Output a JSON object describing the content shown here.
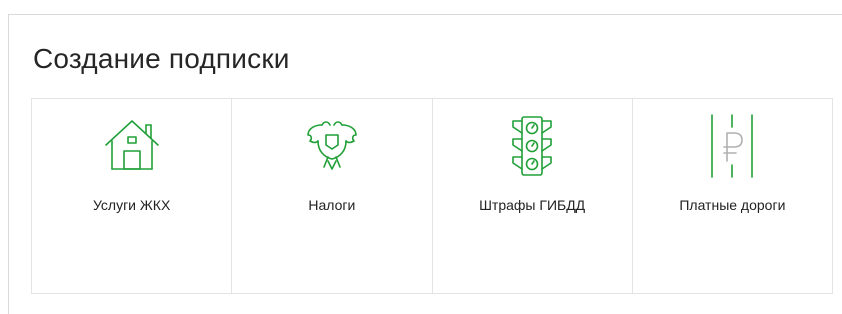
{
  "title": "Создание подписки",
  "accent_color": "#21a038",
  "tiles": [
    {
      "label": "Услуги ЖКХ",
      "icon": "house-icon"
    },
    {
      "label": "Налоги",
      "icon": "eagle-emblem-icon"
    },
    {
      "label": "Штрафы ГИБДД",
      "icon": "traffic-light-icon"
    },
    {
      "label": "Платные дороги",
      "icon": "toll-road-ruble-icon"
    }
  ]
}
